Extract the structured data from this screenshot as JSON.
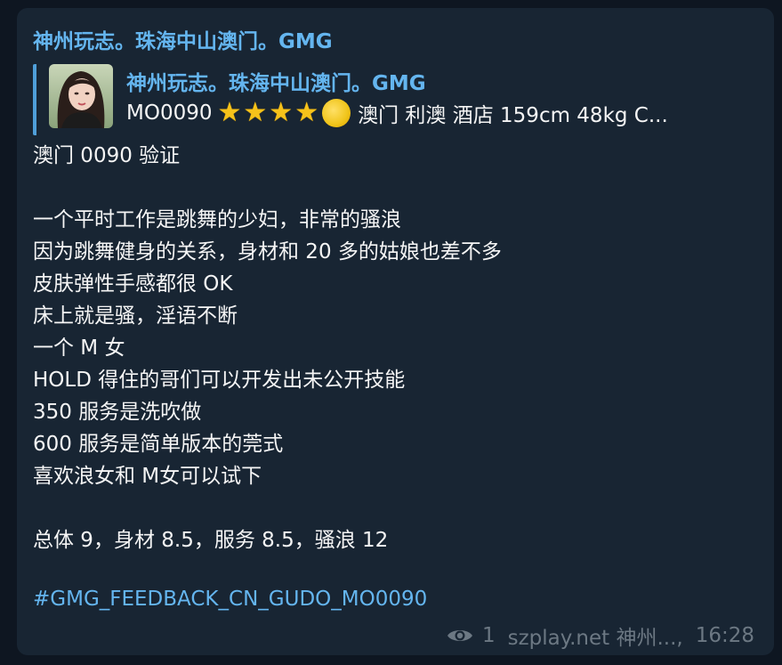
{
  "message": {
    "sender": "神州玩志。珠海中山澳门。GMG",
    "reply": {
      "title": "神州玩志。珠海中山澳门。GMG",
      "code": "MO0090",
      "star_count": 4,
      "partial_rating_icon": "moon-icon",
      "text": "澳门 利澳 酒店 159cm  48kg  C..."
    },
    "lines": [
      "澳门 0090 验证",
      "",
      "一个平时工作是跳舞的少妇，非常的骚浪",
      "因为跳舞健身的关系，身材和 20 多的姑娘也差不多",
      "皮肤弹性手感都很 OK",
      "床上就是骚，淫语不断",
      "一个 M 女",
      "HOLD 得住的哥们可以开发出未公开技能",
      "350 服务是洗吹做",
      "600 服务是简单版本的莞式",
      "喜欢浪女和 M女可以试下",
      "",
      "总体 9，身材 8.5，服务 8.5，骚浪 12"
    ],
    "hashtag": "#GMG_FEEDBACK_CN_GUDO_MO0090",
    "views": "1",
    "signature": "szplay.net 神州...,",
    "time": "16:28"
  },
  "colors": {
    "background": "#0e1621",
    "bubble": "#182533",
    "accent": "#64b5ef",
    "text": "#f5f5f5",
    "meta": "#6c7883"
  }
}
